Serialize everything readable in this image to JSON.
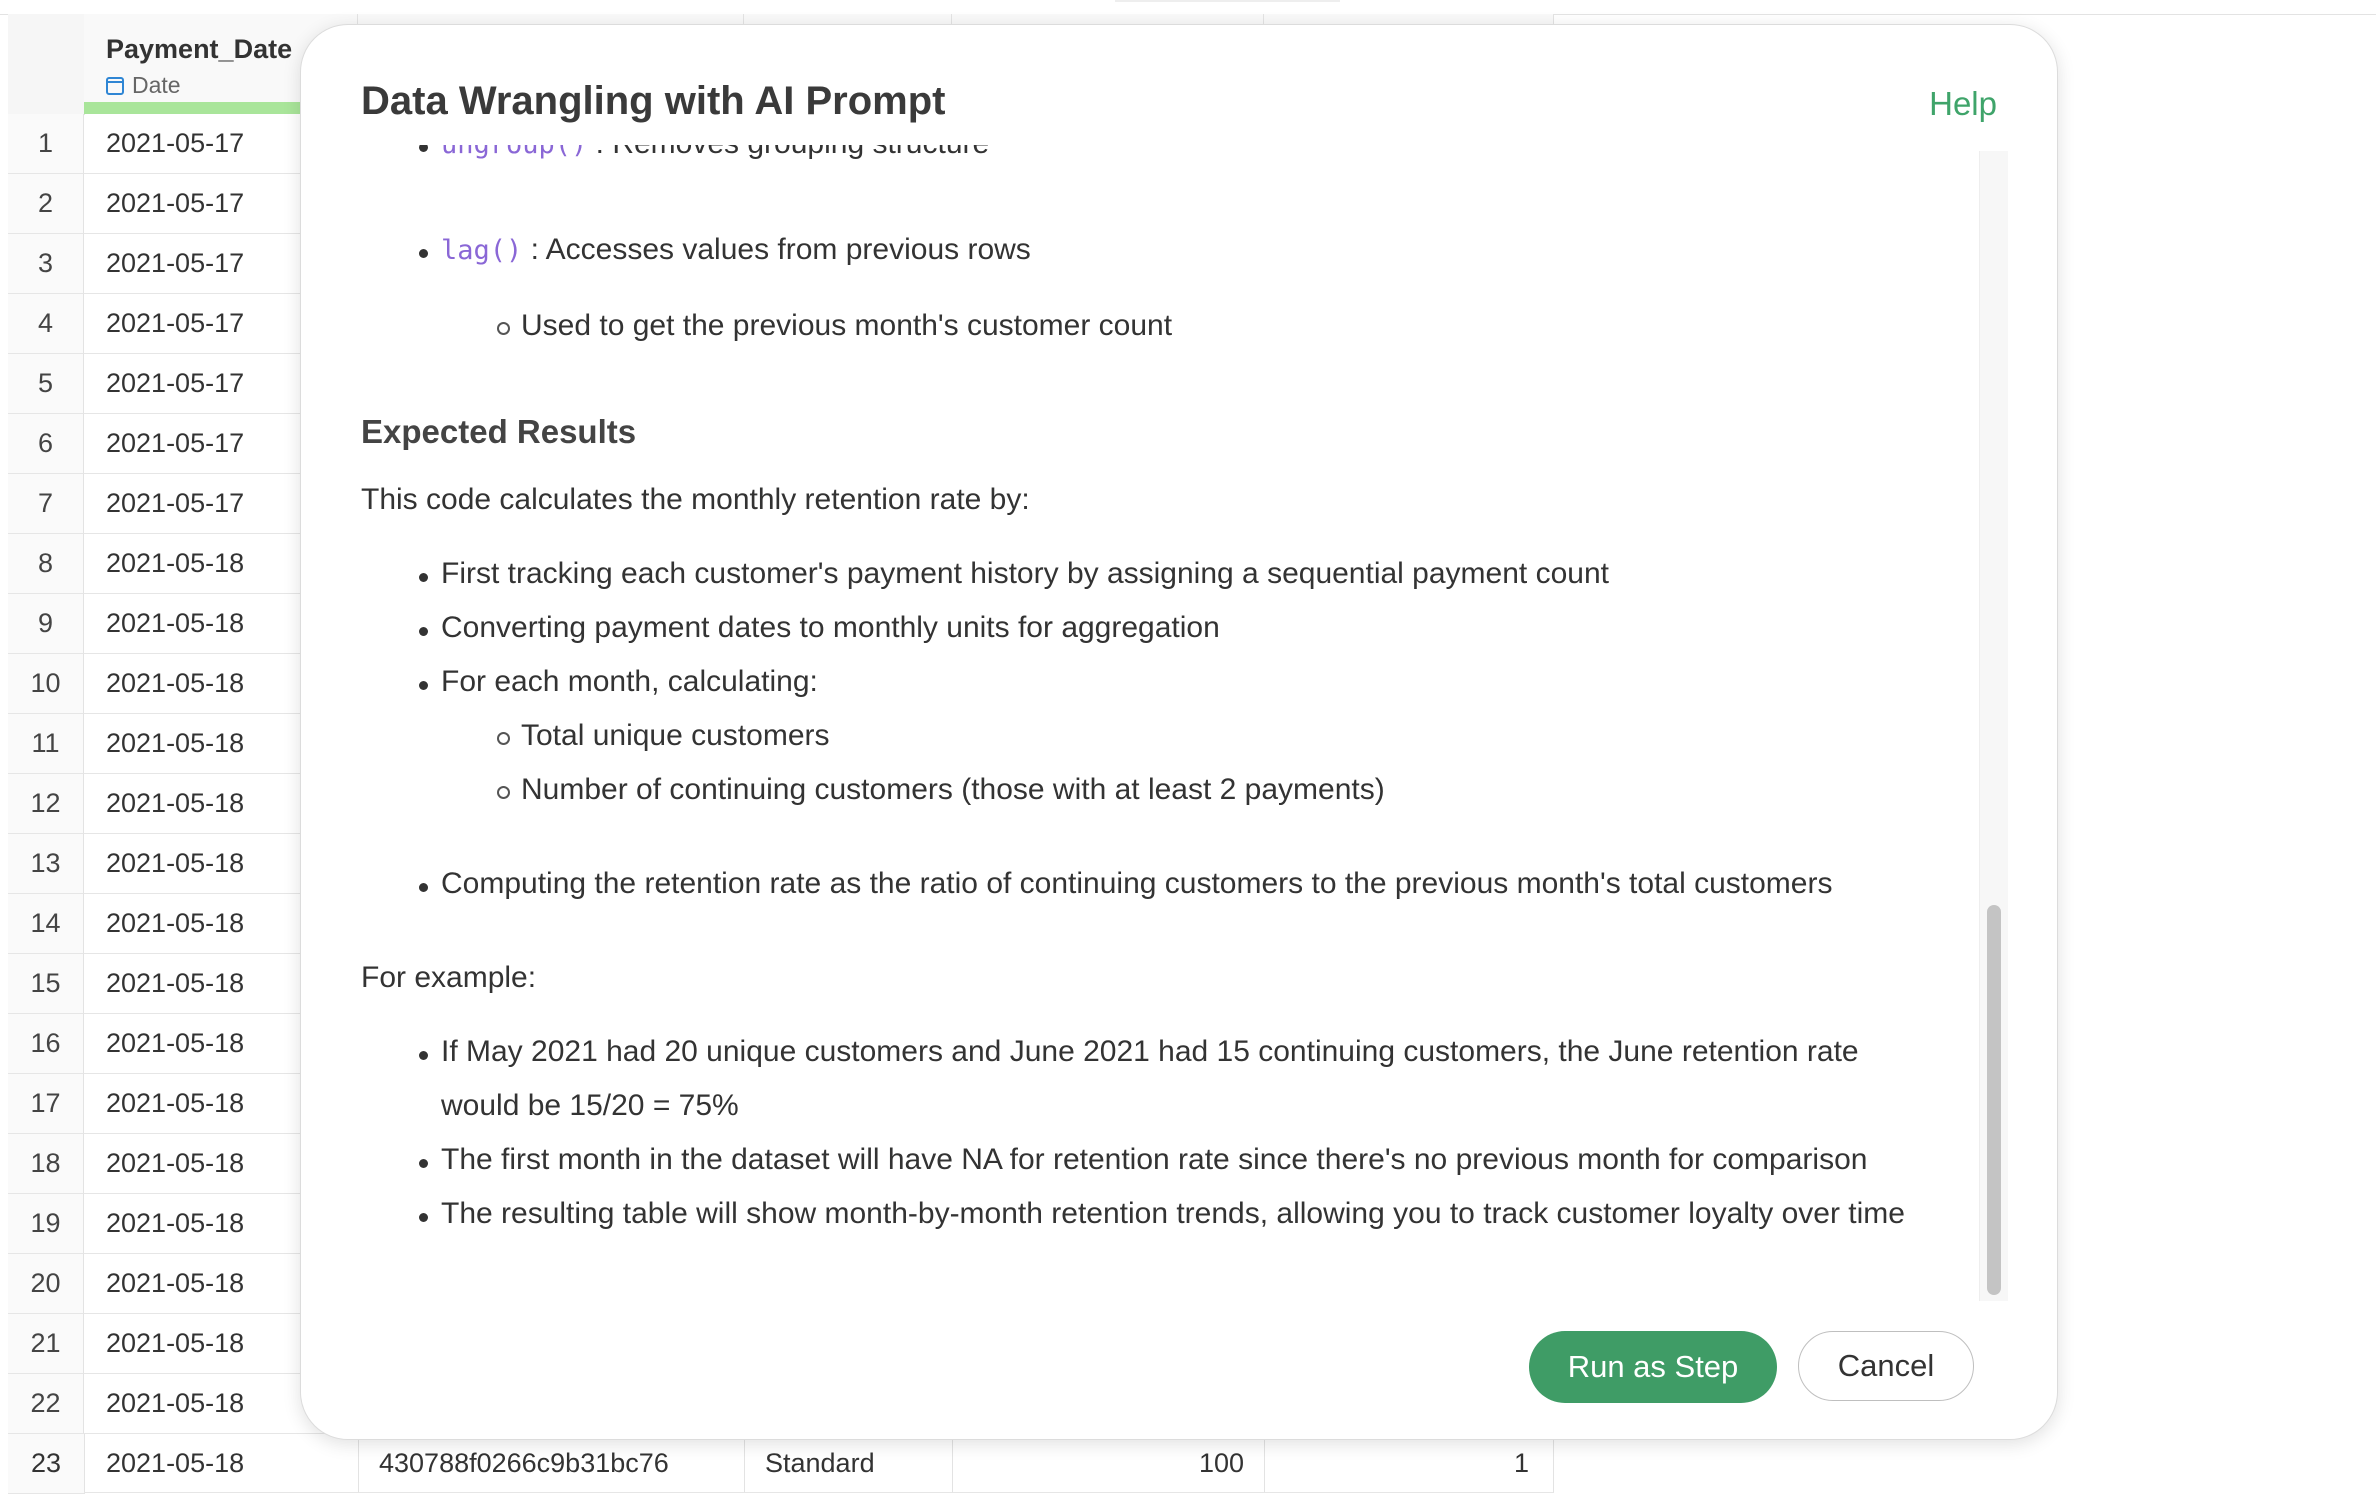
{
  "grid": {
    "column": {
      "name": "Payment_Date",
      "type": "Date"
    },
    "rows": [
      {
        "n": "1",
        "date": "2021-05-17"
      },
      {
        "n": "2",
        "date": "2021-05-17"
      },
      {
        "n": "3",
        "date": "2021-05-17"
      },
      {
        "n": "4",
        "date": "2021-05-17"
      },
      {
        "n": "5",
        "date": "2021-05-17"
      },
      {
        "n": "6",
        "date": "2021-05-17"
      },
      {
        "n": "7",
        "date": "2021-05-17"
      },
      {
        "n": "8",
        "date": "2021-05-18"
      },
      {
        "n": "9",
        "date": "2021-05-18"
      },
      {
        "n": "10",
        "date": "2021-05-18"
      },
      {
        "n": "11",
        "date": "2021-05-18"
      },
      {
        "n": "12",
        "date": "2021-05-18"
      },
      {
        "n": "13",
        "date": "2021-05-18"
      },
      {
        "n": "14",
        "date": "2021-05-18"
      },
      {
        "n": "15",
        "date": "2021-05-18"
      },
      {
        "n": "16",
        "date": "2021-05-18"
      },
      {
        "n": "17",
        "date": "2021-05-18"
      },
      {
        "n": "18",
        "date": "2021-05-18"
      },
      {
        "n": "19",
        "date": "2021-05-18"
      },
      {
        "n": "20",
        "date": "2021-05-18"
      },
      {
        "n": "21",
        "date": "2021-05-18"
      },
      {
        "n": "22",
        "date": "2021-05-18"
      }
    ],
    "last_row": {
      "n": "23",
      "date": "2021-05-18",
      "id": "430788f0266c9b31bc76",
      "plan": "Standard",
      "amount": "100",
      "count": "1"
    }
  },
  "dialog": {
    "title": "Data Wrangling with AI Prompt",
    "help": "Help",
    "partial_item": {
      "code": "ungroup()",
      "text": ": Removes grouping structure"
    },
    "lag_item": {
      "code": "lag()",
      "text": ": Accesses values from previous rows"
    },
    "lag_sub": "Used to get the previous month's customer count",
    "expected_heading": "Expected Results",
    "expected_intro": "This code calculates the monthly retention rate by:",
    "steps": [
      "First tracking each customer's payment history by assigning a sequential payment count",
      "Converting payment dates to monthly units for aggregation",
      "For each month, calculating:"
    ],
    "substeps": [
      "Total unique customers",
      "Number of continuing customers (those with at least 2 payments)"
    ],
    "step_last": "Computing the retention rate as the ratio of continuing customers to the previous month's total customers",
    "example_intro": "For example:",
    "examples": {
      "e1_line1": "If May 2021 had 20 unique customers and June 2021 had 15 continuing customers, the June retention rate",
      "e1_line2": "would be 15/20 = 75%",
      "e2": "The first month in the dataset will have NA for retention rate since there's no previous month for comparison",
      "e3": "The resulting table will show month-by-month retention trends, allowing you to track customer loyalty over time"
    },
    "run_button": "Run as Step",
    "cancel_button": "Cancel",
    "colors": {
      "primary": "#3f9c66",
      "annotation_arrow": "#e8436b",
      "code": "#8a67d6"
    }
  }
}
